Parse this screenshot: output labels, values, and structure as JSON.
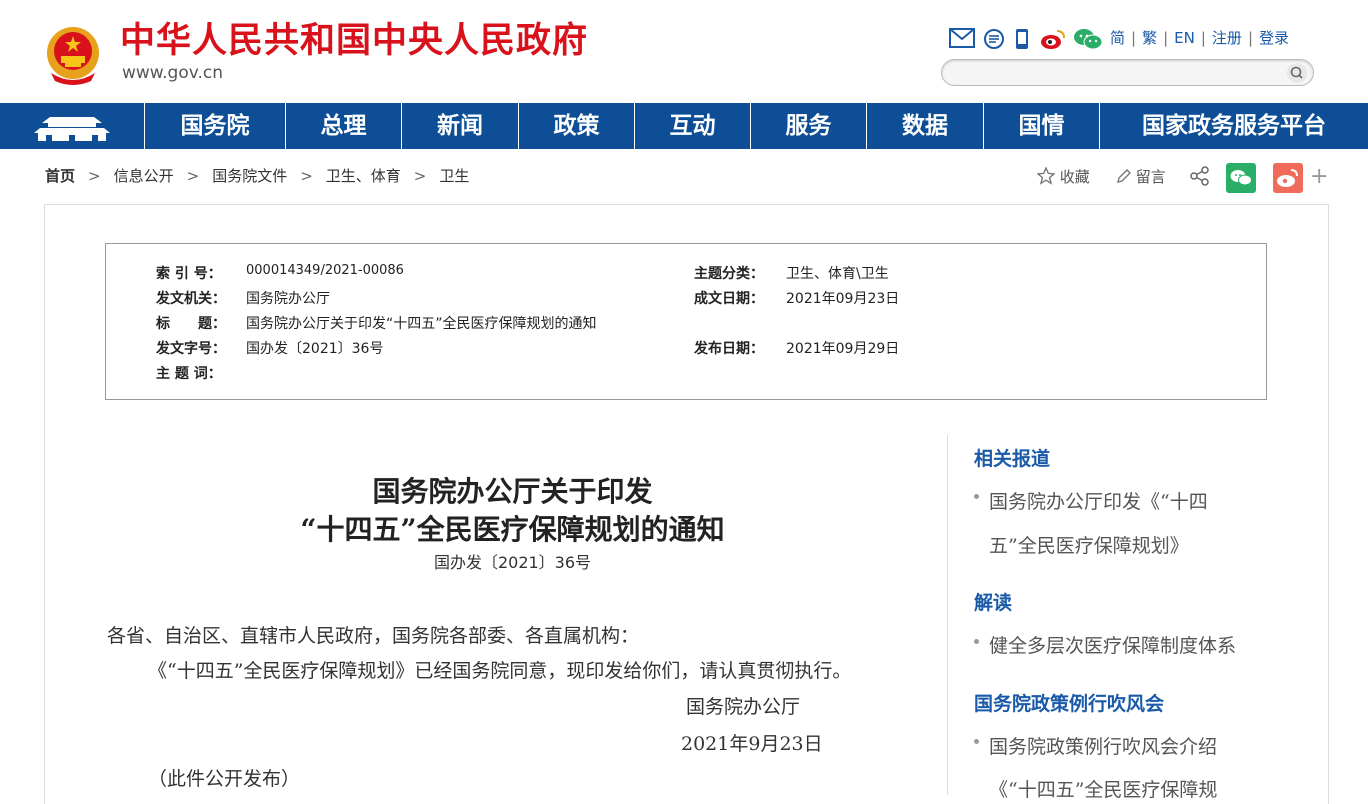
{
  "header": {
    "site_title": "中华人民共和国中央人民政府",
    "site_domain": "www.gov.cn",
    "lang_links": [
      "简",
      "繁",
      "EN",
      "注册",
      "登录"
    ],
    "search_placeholder": ""
  },
  "nav": {
    "items": [
      "国务院",
      "总理",
      "新闻",
      "政策",
      "互动",
      "服务",
      "数据",
      "国情",
      "国家政务服务平台"
    ]
  },
  "breadcrumb": [
    "首页",
    "信息公开",
    "国务院文件",
    "卫生、体育",
    "卫生"
  ],
  "tools": {
    "favorite": "收藏",
    "comment": "留言"
  },
  "meta": {
    "index_label": "索 引 号：",
    "index_value": "000014349/2021-00086",
    "topic_label": "主题分类：",
    "topic_value": "卫生、体育\\卫生",
    "issuer_label": "发文机关：",
    "issuer_value": "国务院办公厅",
    "written_label": "成文日期：",
    "written_value": "2021年09月23日",
    "title_label": "标　　题：",
    "title_value": "国务院办公厅关于印发“十四五”全民医疗保障规划的通知",
    "docno_label": "发文字号：",
    "docno_value": "国办发〔2021〕36号",
    "publish_label": "发布日期：",
    "publish_value": "2021年09月29日",
    "keywords_label": "主 题 词："
  },
  "document": {
    "title_line1": "国务院办公厅关于印发",
    "title_line2": "“十四五”全民医疗保障规划的通知",
    "number": "国办发〔2021〕36号",
    "salutation": "各省、自治区、直辖市人民政府，国务院各部委、各直属机构：",
    "body": "《“十四五”全民医疗保障规划》已经国务院同意，现印发给你们，请认真贯彻执行。",
    "signature": "国务院办公厅",
    "date": "2021年9月23日",
    "note": "（此件公开发布）"
  },
  "sidebar": {
    "related_heading": "相关报道",
    "related_item_line1": "国务院办公厅印发《“十四",
    "related_item_line2": "五”全民医疗保障规划》",
    "interpret_heading": "解读",
    "interpret_item": "健全多层次医疗保障制度体系",
    "briefing_heading": "国务院政策例行吹风会",
    "briefing_item_line1": "国务院政策例行吹风会介绍",
    "briefing_item_line2": "《“十四五”全民医疗保障规"
  },
  "colors": {
    "brand_red": "#d8111b",
    "nav_blue": "#0d4e96",
    "link_blue": "#1a5aa8"
  }
}
